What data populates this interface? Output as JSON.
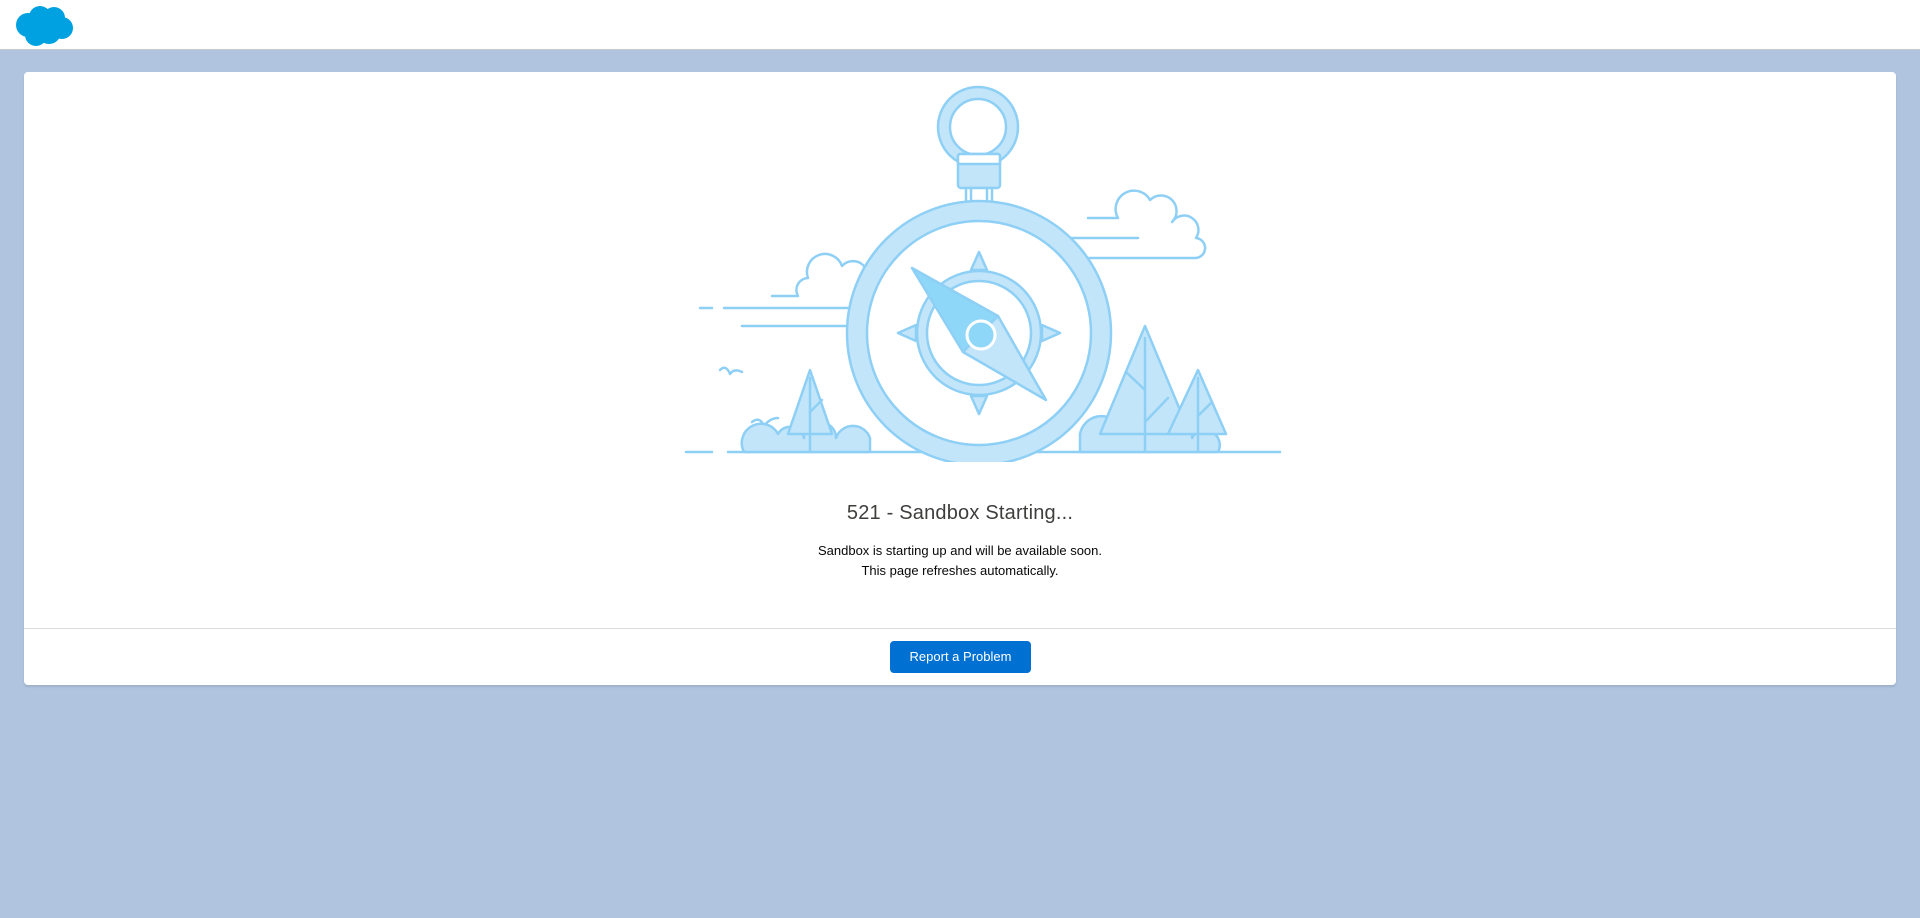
{
  "header": {
    "logo": "salesforce-cloud-logo"
  },
  "error": {
    "title": "521 - Sandbox Starting...",
    "message_line1": "Sandbox is starting up and will be available soon.",
    "message_line2": "This page refreshes automatically."
  },
  "footer": {
    "report_button_label": "Report a Problem"
  },
  "colors": {
    "page_background": "#b0c4df",
    "brand_blue": "#00a1e0",
    "button_blue": "#0070d2",
    "illustration_fill": "#c2e5fa",
    "illustration_stroke": "#8ecff5"
  },
  "icons": [
    "salesforce-cloud-logo",
    "compass-stopwatch-illustration"
  ]
}
